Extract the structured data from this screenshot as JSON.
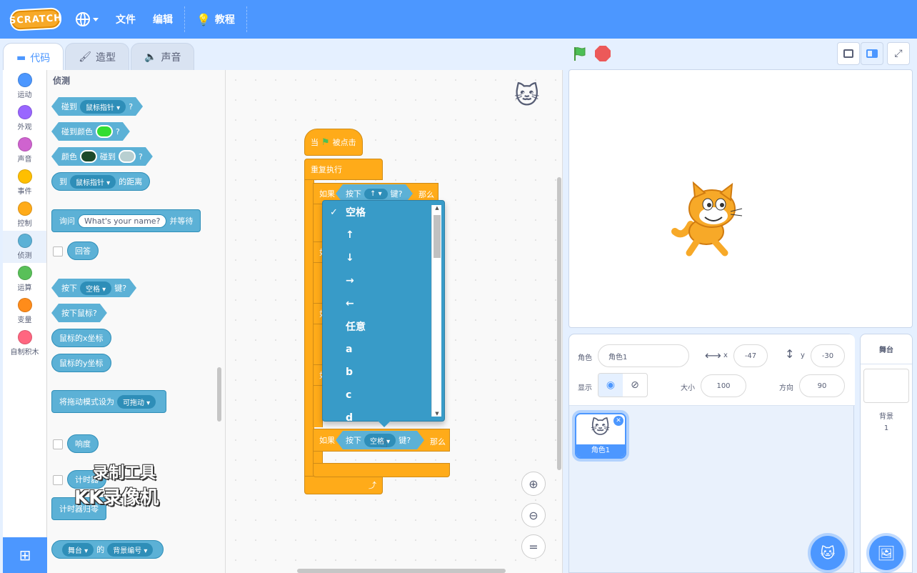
{
  "menu": {
    "logo": "SCRATCH",
    "file": "文件",
    "edit": "编辑",
    "tutorials": "教程"
  },
  "tabs": [
    {
      "label": "代码",
      "icon": "code-icon",
      "active": true
    },
    {
      "label": "造型",
      "icon": "brush-icon",
      "active": false
    },
    {
      "label": "声音",
      "icon": "speaker-icon",
      "active": false
    }
  ],
  "categories": [
    {
      "label": "运动",
      "color": "#4c97ff"
    },
    {
      "label": "外观",
      "color": "#9966ff"
    },
    {
      "label": "声音",
      "color": "#cf63cf"
    },
    {
      "label": "事件",
      "color": "#ffbf00"
    },
    {
      "label": "控制",
      "color": "#ffab19"
    },
    {
      "label": "侦测",
      "color": "#5cb1d6"
    },
    {
      "label": "运算",
      "color": "#59c059"
    },
    {
      "label": "变量",
      "color": "#ff8c1a"
    },
    {
      "label": "自制积木",
      "color": "#ff6680"
    }
  ],
  "palette": {
    "title": "侦测",
    "touching": "碰到",
    "mouse_pointer": "鼠标指针",
    "q": "?",
    "touching_color": "碰到颜色",
    "color": "颜色",
    "touch": "碰到",
    "to": "到",
    "distance": "的距离",
    "ask": "询问",
    "ask_default": "What's your name?",
    "and_wait": "并等待",
    "answer": "回答",
    "key_press": "按下",
    "space": "空格",
    "key_q": "键?",
    "mouse_down": "按下鼠标?",
    "mouse_x": "鼠标的x坐标",
    "mouse_y": "鼠标的y坐标",
    "drag_mode": "将拖动模式设为",
    "draggable": "可拖动",
    "loudness": "响度",
    "timer": "计时器",
    "reset_timer": "计时器归零",
    "stage": "舞台",
    "of": "的",
    "backdrop_num": "背景编号",
    "swatch_green": "#33dd33",
    "swatch_dark": "#1d4a2b",
    "swatch_grey": "#b8cfd1"
  },
  "script": {
    "when_flag": "当",
    "clicked": "被点击",
    "forever": "重复执行",
    "if": "如果",
    "press": "按下",
    "key_up": "↑",
    "key_q": "键?",
    "then": "那么",
    "space": "空格"
  },
  "dropdown": {
    "items": [
      "空格",
      "↑",
      "↓",
      "→",
      "←",
      "任意",
      "a",
      "b",
      "c",
      "d"
    ],
    "selected": "空格"
  },
  "watermark": {
    "line1": "录制工具",
    "line2": "KK录像机"
  },
  "sprite_info": {
    "sprite_label": "角色",
    "sprite_name": "角色1",
    "x_label": "x",
    "x_value": "-47",
    "y_label": "y",
    "y_value": "-30",
    "show_label": "显示",
    "size_label": "大小",
    "size_value": "100",
    "direction_label": "方向",
    "direction_value": "90"
  },
  "sprites": [
    {
      "name": "角色1"
    }
  ],
  "stage_panel": {
    "title": "舞台",
    "backdrop_label": "背景",
    "backdrop_count": "1"
  }
}
